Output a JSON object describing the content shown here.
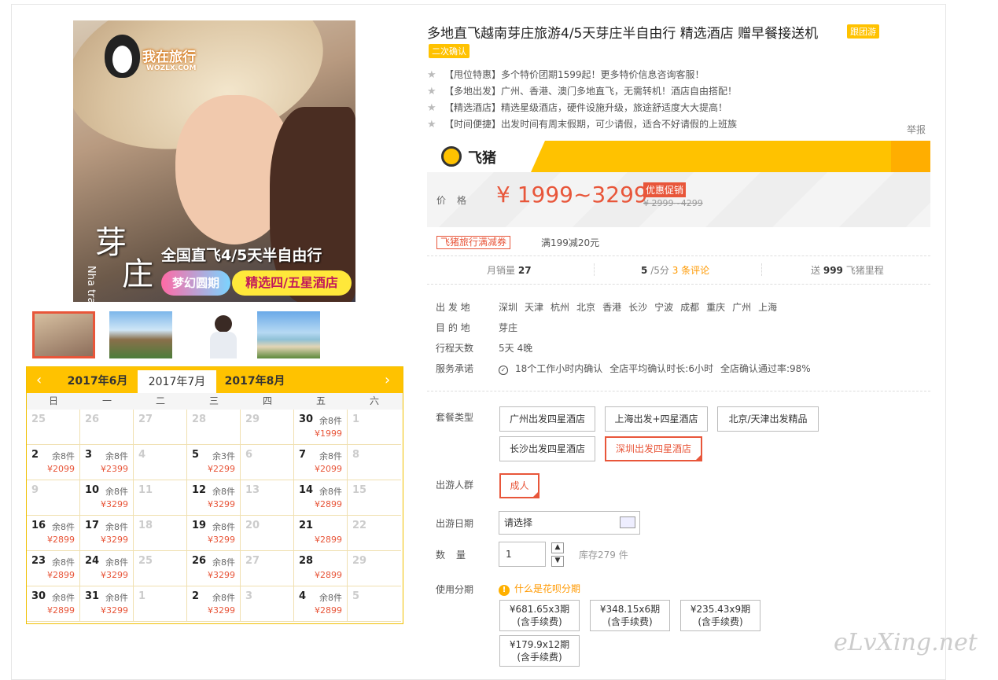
{
  "product": {
    "title": "多地直飞越南芽庄旅游4/5天芽庄半自由行 精选酒店 赠早餐接送机",
    "tag_group": "跟团游",
    "tag_confirm": "二次确认",
    "features": [
      "【甩位特惠】多个特价团期1599起！更多特价信息咨询客服！",
      "【多地出发】广州、香港、澳门多地直飞，无需转机！酒店自由搭配！",
      "【精选酒店】精选星级酒店，硬件设施升级，旅途舒适度大大提高！",
      "【时间便捷】出发时间有周末假期，可少请假，适合不好请假的上班族"
    ],
    "report": "举报"
  },
  "image": {
    "logo_text": "我在旅行",
    "logo_sub": "WOZLX.COM",
    "cn_a": "芽",
    "cn_b": "庄",
    "en": "Nha trang",
    "headline": "全国直飞4/5天半自由行",
    "badge": "梦幻圆期",
    "sub": "精选四/五星酒店"
  },
  "fliggy": {
    "name": "飞猪"
  },
  "price": {
    "label": "价格",
    "value": "¥ 1999~3299",
    "promo": "优惠促销",
    "original": "¥ 2999~4299"
  },
  "coupon": {
    "label": "飞猪旅行满减券",
    "desc": "满199减20元"
  },
  "stats": {
    "sales_label": "月销量",
    "sales": "27",
    "rating": "5",
    "rating_suffix": "/5分",
    "reviews": "3 条评论",
    "mile_prefix": "送",
    "miles": "999",
    "mile_suffix": "飞猪里程"
  },
  "info": {
    "depart_label": "出 发 地",
    "depart_cities": [
      "深圳",
      "天津",
      "杭州",
      "北京",
      "香港",
      "长沙",
      "宁波",
      "成都",
      "重庆",
      "广州",
      "上海"
    ],
    "dest_label": "目 的 地",
    "dest": "芽庄",
    "days_label": "行程天数",
    "days": "5天 4晚",
    "promise_label": "服务承诺",
    "promise_a": "18个工作小时内确认",
    "promise_b": "全店平均确认时长:6小时",
    "promise_c": "全店确认通过率:98%"
  },
  "form": {
    "package_label": "套餐类型",
    "packages": [
      "广州出发四星酒店",
      "上海出发+四星酒店",
      "北京/天津出发精品",
      "长沙出发四星酒店",
      "深圳出发四星酒店"
    ],
    "group_label": "出游人群",
    "group": "成人",
    "date_label": "出游日期",
    "date_placeholder": "请选择",
    "qty_label": "数量",
    "qty": "1",
    "stock": "库存279 件",
    "install_label": "使用分期",
    "huabei": "什么是花呗分期",
    "installments": [
      {
        "amt": "¥681.65x3期",
        "fee": "(含手续费)"
      },
      {
        "amt": "¥348.15x6期",
        "fee": "(含手续费)"
      },
      {
        "amt": "¥235.43x9期",
        "fee": "(含手续费)"
      },
      {
        "amt": "¥179.9x12期",
        "fee": "(含手续费)"
      }
    ]
  },
  "calendar": {
    "months": [
      "2017年6月",
      "2017年7月",
      "2017年8月"
    ],
    "weekdays": [
      "日",
      "一",
      "二",
      "三",
      "四",
      "五",
      "六"
    ],
    "weeks": [
      [
        {
          "d": "25",
          "g": true
        },
        {
          "d": "26",
          "g": true
        },
        {
          "d": "27",
          "g": true
        },
        {
          "d": "28",
          "g": true
        },
        {
          "d": "29",
          "g": true
        },
        {
          "d": "30",
          "s": "余8件",
          "p": "¥1999"
        },
        {
          "d": "1",
          "g": true
        }
      ],
      [
        {
          "d": "2",
          "s": "余8件",
          "p": "¥2099"
        },
        {
          "d": "3",
          "s": "余8件",
          "p": "¥2399"
        },
        {
          "d": "4",
          "g": true
        },
        {
          "d": "5",
          "s": "余3件",
          "p": "¥2299"
        },
        {
          "d": "6",
          "g": true
        },
        {
          "d": "7",
          "s": "余8件",
          "p": "¥2099"
        },
        {
          "d": "8",
          "g": true
        }
      ],
      [
        {
          "d": "9",
          "g": true
        },
        {
          "d": "10",
          "s": "余8件",
          "p": "¥3299"
        },
        {
          "d": "11",
          "g": true
        },
        {
          "d": "12",
          "s": "余8件",
          "p": "¥3299"
        },
        {
          "d": "13",
          "g": true
        },
        {
          "d": "14",
          "s": "余8件",
          "p": "¥2899"
        },
        {
          "d": "15",
          "g": true
        }
      ],
      [
        {
          "d": "16",
          "s": "余8件",
          "p": "¥2899"
        },
        {
          "d": "17",
          "s": "余8件",
          "p": "¥3299"
        },
        {
          "d": "18",
          "g": true
        },
        {
          "d": "19",
          "s": "余8件",
          "p": "¥3299"
        },
        {
          "d": "20",
          "g": true
        },
        {
          "d": "21",
          "s": "",
          "p": "¥2899"
        },
        {
          "d": "22",
          "g": true
        }
      ],
      [
        {
          "d": "23",
          "s": "余8件",
          "p": "¥2899"
        },
        {
          "d": "24",
          "s": "余8件",
          "p": "¥3299"
        },
        {
          "d": "25",
          "g": true
        },
        {
          "d": "26",
          "s": "余8件",
          "p": "¥3299"
        },
        {
          "d": "27",
          "g": true
        },
        {
          "d": "28",
          "s": "",
          "p": "¥2899"
        },
        {
          "d": "29",
          "g": true
        }
      ],
      [
        {
          "d": "30",
          "s": "余8件",
          "p": "¥2899"
        },
        {
          "d": "31",
          "s": "余8件",
          "p": "¥3299"
        },
        {
          "d": "1",
          "g": true
        },
        {
          "d": "2",
          "s": "余8件",
          "p": "¥3299"
        },
        {
          "d": "3",
          "g": true
        },
        {
          "d": "4",
          "s": "余8件",
          "p": "¥2899"
        },
        {
          "d": "5",
          "g": true
        }
      ]
    ]
  },
  "watermark": "eLvXing.net"
}
